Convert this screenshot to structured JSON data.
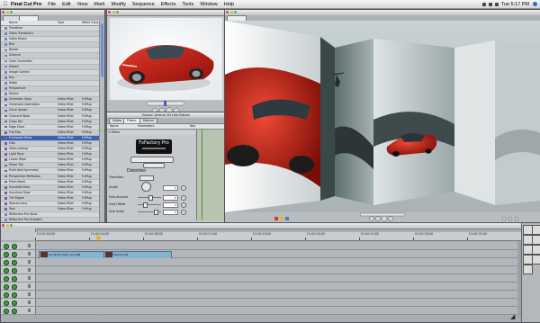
{
  "menubar": {
    "app_name": "Final Cut Pro",
    "items": [
      "File",
      "Edit",
      "View",
      "Mark",
      "Modify",
      "Sequence",
      "Effects",
      "Tools",
      "Window",
      "Help"
    ],
    "clock": "Tue 5:17 PM"
  },
  "browser": {
    "title": "",
    "tabs": [
      "",
      ""
    ],
    "columns": [
      "Name",
      "Type",
      "Effect Class"
    ],
    "rows": [
      {
        "name": "Transition",
        "type": "",
        "cls": ""
      },
      {
        "name": "Video Transitions",
        "type": "",
        "cls": ""
      },
      {
        "name": "Video Filters",
        "type": "",
        "cls": ""
      },
      {
        "name": "Blur",
        "type": "",
        "cls": ""
      },
      {
        "name": "Border",
        "type": "",
        "cls": ""
      },
      {
        "name": "Channel",
        "type": "",
        "cls": ""
      },
      {
        "name": "Color Correction",
        "type": "",
        "cls": ""
      },
      {
        "name": "Distort",
        "type": "",
        "cls": ""
      },
      {
        "name": "Image Control",
        "type": "",
        "cls": ""
      },
      {
        "name": "Key",
        "type": "",
        "cls": ""
      },
      {
        "name": "Matte",
        "type": "",
        "cls": ""
      },
      {
        "name": "Perspective",
        "type": "",
        "cls": ""
      },
      {
        "name": "Stylize",
        "type": "",
        "cls": ""
      },
      {
        "name": "Cinematic Glow",
        "type": "Video Filter",
        "cls": "FxPlug"
      },
      {
        "name": "Chromatic Aberration",
        "type": "Video Filter",
        "cls": "FxPlug"
      },
      {
        "name": "Circle Splash",
        "type": "Video Filter",
        "cls": "FxPlug"
      },
      {
        "name": "Crescent Wrap",
        "type": "Video Filter",
        "cls": "FxPlug"
      },
      {
        "name": "Cross Fan",
        "type": "Video Filter",
        "cls": "FxPlug"
      },
      {
        "name": "Edge Glow",
        "type": "Video Filter",
        "cls": "FxPlug"
      },
      {
        "name": "Flip Flop",
        "type": "Video Filter",
        "cls": "FxPlug"
      },
      {
        "name": "Funhouse Mirror",
        "type": "Video Filter",
        "cls": "FxPlug"
      },
      {
        "name": "Fold",
        "type": "Video Filter",
        "cls": "FxPlug"
      },
      {
        "name": "Glass Lookup",
        "type": "Video Filter",
        "cls": "FxPlug"
      },
      {
        "name": "Light Rays",
        "type": "Video Filter",
        "cls": "FxPlug"
      },
      {
        "name": "Linear Wipe",
        "type": "Video Filter",
        "cls": "FxPlug"
      },
      {
        "name": "Mirror Tile",
        "type": "Video Filter",
        "cls": "FxPlug"
      },
      {
        "name": "Multi Wall Symmetry",
        "type": "Video Filter",
        "cls": "FxPlug"
      },
      {
        "name": "Perspective Reflection",
        "type": "Video Filter",
        "cls": "FxPlug"
      },
      {
        "name": "Pinch Panel",
        "type": "Video Filter",
        "cls": "FxPlug"
      },
      {
        "name": "Sunshaft Glow",
        "type": "Video Filter",
        "cls": "FxPlug"
      },
      {
        "name": "Sunshine Glow",
        "type": "Video Filter",
        "cls": "FxPlug"
      },
      {
        "name": "Tile Ripple",
        "type": "Video Filter",
        "cls": "FxPlug"
      },
      {
        "name": "Texture Lens",
        "type": "Video Filter",
        "cls": "FxPlug"
      },
      {
        "name": "Twirl",
        "type": "Video Filter",
        "cls": "FxPlug"
      },
      {
        "name": "Reflective Pro Glass",
        "type": "",
        "cls": ""
      },
      {
        "name": "Reflective Pro Gradient",
        "type": "",
        "cls": ""
      },
      {
        "name": "Reflective Pro Kaleidos",
        "type": "",
        "cls": ""
      },
      {
        "name": "Reflective Pro Light",
        "type": "",
        "cls": ""
      },
      {
        "name": "Reflective Pro Stylize",
        "type": "",
        "cls": ""
      },
      {
        "name": "Reflective Pro Tiling",
        "type": "",
        "cls": ""
      },
      {
        "name": "Reflective Pro Video",
        "type": "",
        "cls": ""
      }
    ],
    "selected_index": 20
  },
  "viewer": {
    "title": "",
    "timecode_in": "",
    "timecode_out": ""
  },
  "effects": {
    "title": "Viewer: Vertical 3D Fold Pattern",
    "tabs": [
      "Video",
      "Filters",
      "Motion"
    ],
    "columns": [
      "Name",
      "Parameters",
      "Nav"
    ],
    "brand": "FxFactory Pro",
    "section": "Distortion",
    "params": [
      {
        "label": "Transition",
        "value": ""
      },
      {
        "label": "Angle",
        "value": "0"
      },
      {
        "label": "Fold Amount",
        "value": "0"
      },
      {
        "label": "Fold Offset",
        "value": "0"
      },
      {
        "label": "Size Scale",
        "value": "0"
      }
    ]
  },
  "canvas": {
    "title": "",
    "timecode": ""
  },
  "timeline": {
    "title": "",
    "ruler_timecodes": [
      "01:00:00;00",
      "01:00:04;00",
      "01:00:08;00",
      "01:00:12;00",
      "01:00:16;00",
      "01:00:20;00",
      "01:00:24;00",
      "01:00:28;00",
      "01:00:32;00"
    ],
    "clips": [
      {
        "name": "Car Photo Hero_LG_KSB",
        "track": 1
      },
      {
        "name": "Helmet_LM",
        "track": 1
      }
    ]
  },
  "colors": {
    "accent": "#3b63b0",
    "clip": "#84b3cf",
    "car_red": "#c81e16",
    "window_bg": "#c5c8cc"
  }
}
